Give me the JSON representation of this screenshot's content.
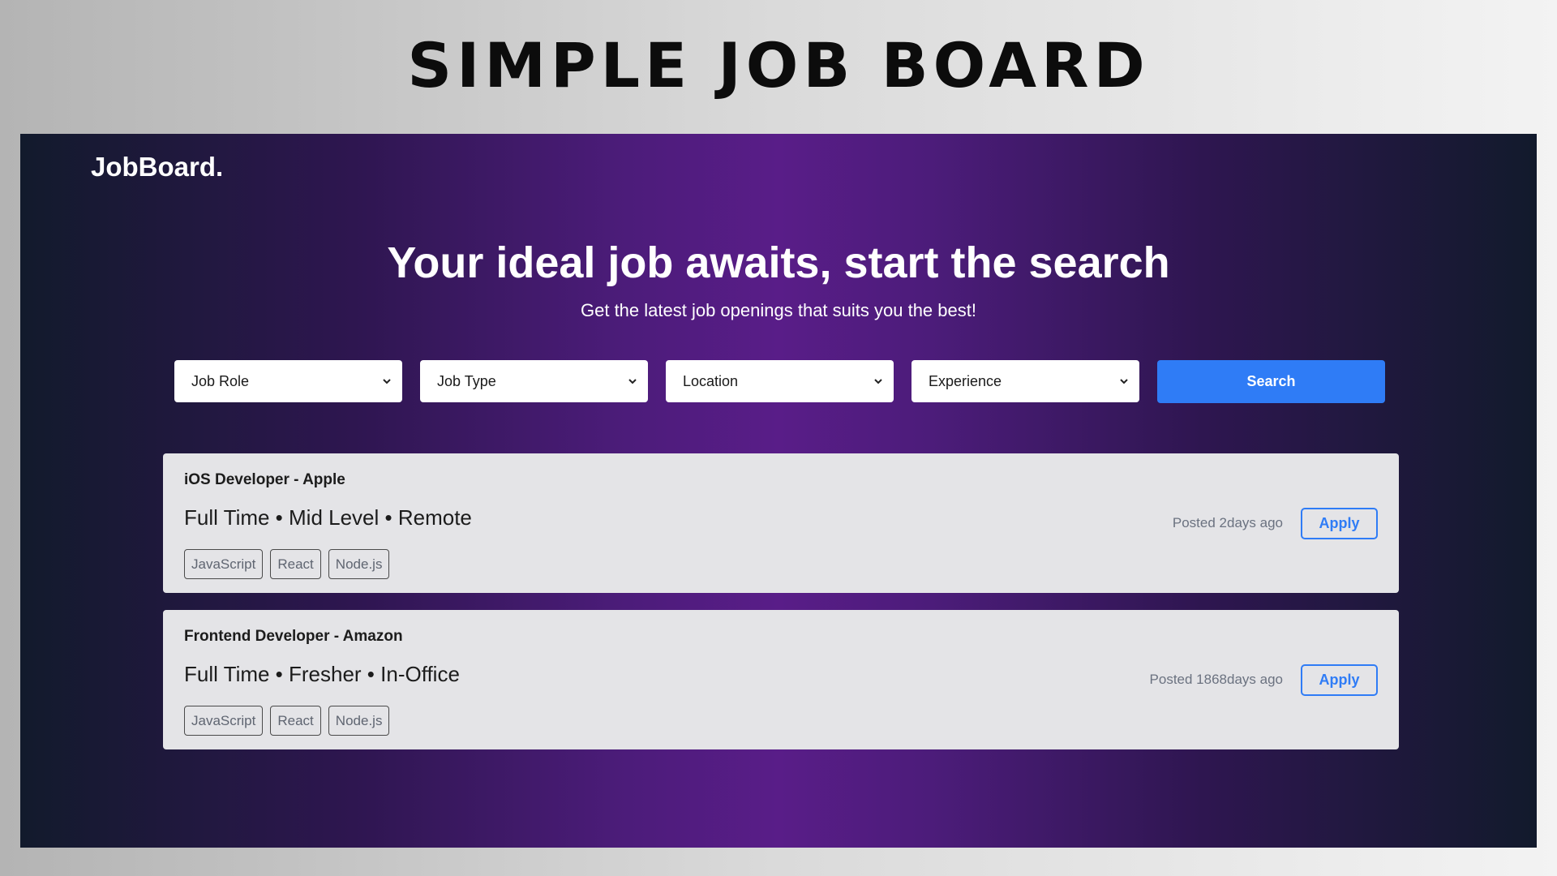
{
  "banner": {
    "title": "SIMPLE JOB BOARD"
  },
  "app": {
    "logo": "JobBoard.",
    "hero": {
      "title": "Your ideal job awaits, start the search",
      "subtitle": "Get the latest job openings that suits you the best!"
    },
    "filters": {
      "job_role": "Job Role",
      "job_type": "Job Type",
      "location": "Location",
      "experience": "Experience",
      "search_label": "Search",
      "chevron_icon": "chevron-down-icon"
    },
    "jobs": [
      {
        "title": "iOS Developer - Apple",
        "meta": "Full Time • Mid Level • Remote",
        "tags": [
          "JavaScript",
          "React",
          "Node.js"
        ],
        "posted": "Posted 2days ago",
        "apply_label": "Apply"
      },
      {
        "title": "Frontend Developer - Amazon",
        "meta": "Full Time • Fresher • In-Office",
        "tags": [
          "JavaScript",
          "React",
          "Node.js"
        ],
        "posted": "Posted 1868days ago",
        "apply_label": "Apply"
      }
    ]
  },
  "colors": {
    "accent": "#2f7cf6",
    "card_bg": "#e4e4e7",
    "gradient_center": "#591d88",
    "gradient_edge": "#121a2c"
  }
}
